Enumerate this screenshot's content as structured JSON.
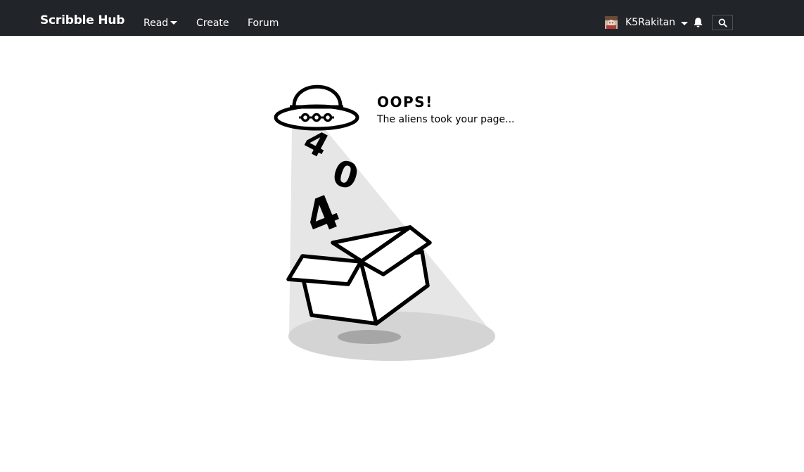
{
  "navbar": {
    "brand": "Scribble Hub",
    "links": {
      "read": "Read",
      "create": "Create",
      "forum": "Forum"
    },
    "user": {
      "name": "K5Rakitan"
    },
    "icons": {
      "avatar": "avatar-image",
      "caret": "caret-down-icon",
      "bell": "bell-icon",
      "search": "search-icon"
    },
    "colors": {
      "background": "#212529",
      "text": "#ffffff"
    }
  },
  "error": {
    "title": "OOPS!",
    "message": "The aliens took your page...",
    "digits": [
      "4",
      "0",
      "4"
    ]
  }
}
